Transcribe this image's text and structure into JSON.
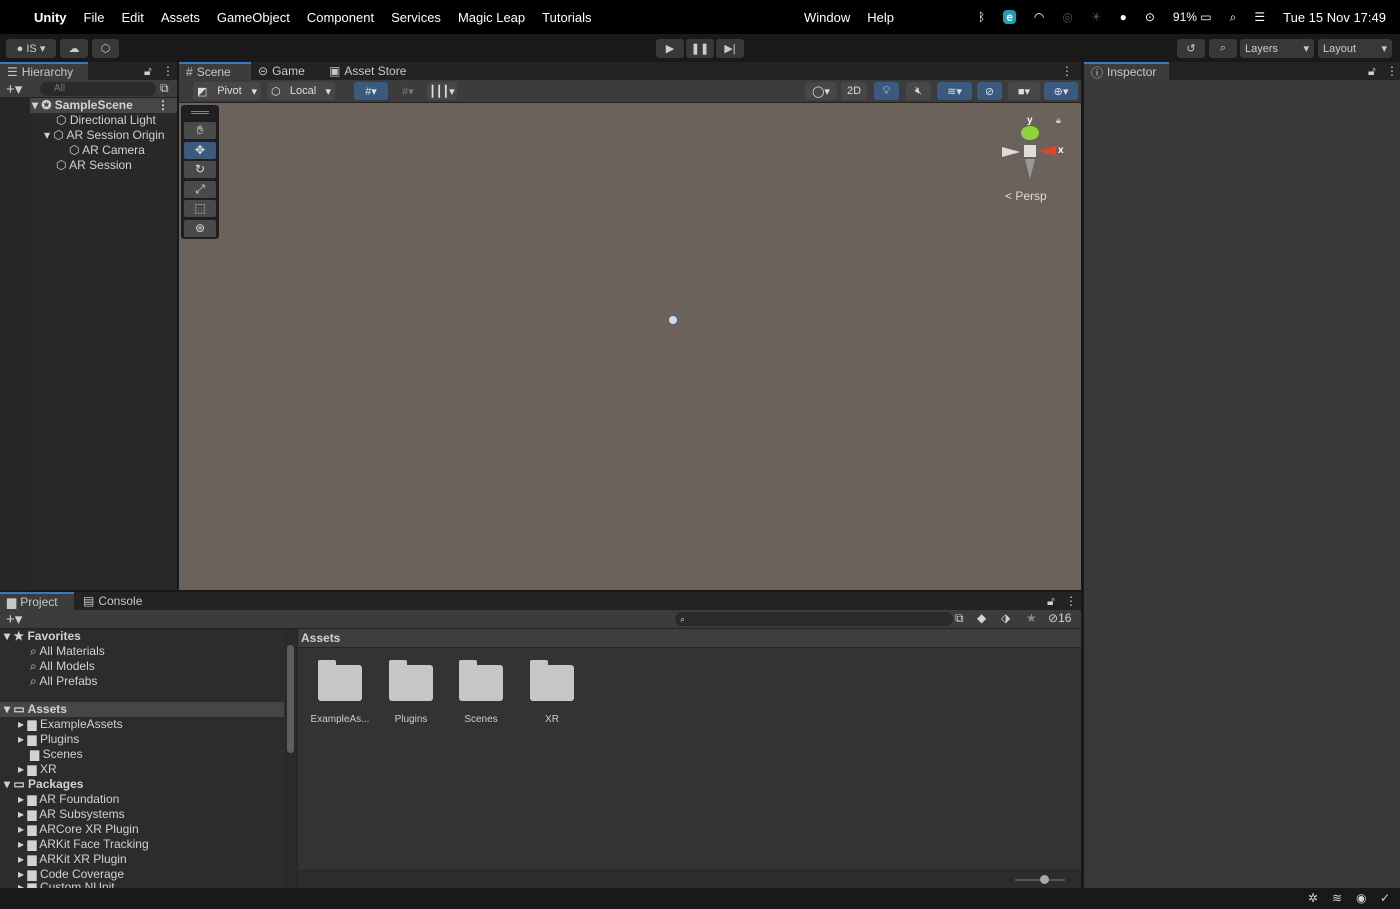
{
  "menubar": {
    "app": "Unity",
    "items": [
      "File",
      "Edit",
      "Assets",
      "GameObject",
      "Component",
      "Services",
      "Magic Leap",
      "Tutorials"
    ],
    "right_items": [
      "Window",
      "Help"
    ],
    "battery": "91%",
    "datetime": "Tue 15 Nov  17:49"
  },
  "toolbar": {
    "account": "IS",
    "layers": "Layers",
    "layout": "Layout"
  },
  "hierarchy": {
    "tab": "Hierarchy",
    "search_placeholder": "All",
    "scene": "SampleScene",
    "items": [
      {
        "label": "Directional Light",
        "depth": 1
      },
      {
        "label": "AR Session Origin",
        "depth": 1
      },
      {
        "label": "AR Camera",
        "depth": 2
      },
      {
        "label": "AR Session",
        "depth": 1
      }
    ]
  },
  "scene": {
    "tabs": [
      "Scene",
      "Game",
      "Asset Store"
    ],
    "pivot": "Pivot",
    "local": "Local",
    "mode2d": "2D",
    "persp": "Persp",
    "gizmo_y": "y",
    "gizmo_x": "x",
    "viewport_color": "#6a625b"
  },
  "inspector": {
    "tab": "Inspector"
  },
  "project": {
    "tabs": [
      "Project",
      "Console"
    ],
    "hidden_count": "16",
    "header": "Assets",
    "favorites": {
      "label": "Favorites",
      "items": [
        "All Materials",
        "All Models",
        "All Prefabs"
      ]
    },
    "assets": {
      "label": "Assets",
      "items": [
        "ExampleAssets",
        "Plugins",
        "Scenes",
        "XR"
      ]
    },
    "packages": {
      "label": "Packages",
      "items": [
        "AR Foundation",
        "AR Subsystems",
        "ARCore XR Plugin",
        "ARKit Face Tracking",
        "ARKit XR Plugin",
        "Code Coverage",
        "Custom NUnit"
      ]
    },
    "grid": [
      "ExampleAs...",
      "Plugins",
      "Scenes",
      "XR"
    ]
  },
  "colors": {
    "accent": "#3a79bb",
    "panel": "#282828",
    "toggle_on": "#3a5a80"
  }
}
